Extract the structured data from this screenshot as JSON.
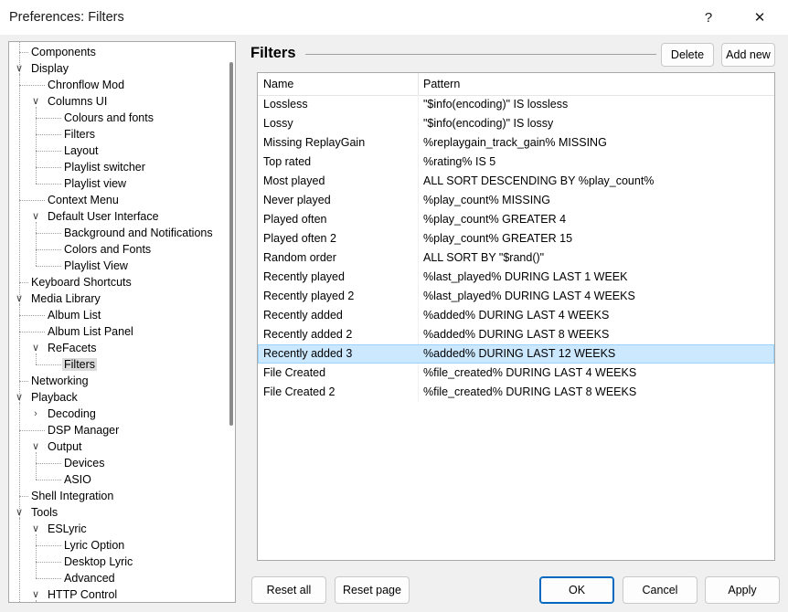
{
  "window": {
    "title": "Preferences: Filters",
    "help_label": "?",
    "close_label": "✕"
  },
  "tree": {
    "items": [
      {
        "label": "Components",
        "level": 0,
        "toggle": "none"
      },
      {
        "label": "Display",
        "level": 0,
        "toggle": "expanded"
      },
      {
        "label": "Chronflow Mod",
        "level": 1,
        "toggle": "none"
      },
      {
        "label": "Columns UI",
        "level": 1,
        "toggle": "expanded"
      },
      {
        "label": "Colours and fonts",
        "level": 2,
        "toggle": "none"
      },
      {
        "label": "Filters",
        "level": 2,
        "toggle": "none"
      },
      {
        "label": "Layout",
        "level": 2,
        "toggle": "none"
      },
      {
        "label": "Playlist switcher",
        "level": 2,
        "toggle": "none"
      },
      {
        "label": "Playlist view",
        "level": 2,
        "toggle": "none"
      },
      {
        "label": "Context Menu",
        "level": 1,
        "toggle": "none"
      },
      {
        "label": "Default User Interface",
        "level": 1,
        "toggle": "expanded"
      },
      {
        "label": "Background and Notifications",
        "level": 2,
        "toggle": "none"
      },
      {
        "label": "Colors and Fonts",
        "level": 2,
        "toggle": "none"
      },
      {
        "label": "Playlist View",
        "level": 2,
        "toggle": "none"
      },
      {
        "label": "Keyboard Shortcuts",
        "level": 0,
        "toggle": "none"
      },
      {
        "label": "Media Library",
        "level": 0,
        "toggle": "expanded"
      },
      {
        "label": "Album List",
        "level": 1,
        "toggle": "none"
      },
      {
        "label": "Album List Panel",
        "level": 1,
        "toggle": "none"
      },
      {
        "label": "ReFacets",
        "level": 1,
        "toggle": "expanded"
      },
      {
        "label": "Filters",
        "level": 2,
        "toggle": "none",
        "selected": true
      },
      {
        "label": "Networking",
        "level": 0,
        "toggle": "none"
      },
      {
        "label": "Playback",
        "level": 0,
        "toggle": "expanded"
      },
      {
        "label": "Decoding",
        "level": 1,
        "toggle": "collapsed"
      },
      {
        "label": "DSP Manager",
        "level": 1,
        "toggle": "none"
      },
      {
        "label": "Output",
        "level": 1,
        "toggle": "expanded"
      },
      {
        "label": "Devices",
        "level": 2,
        "toggle": "none"
      },
      {
        "label": "ASIO",
        "level": 2,
        "toggle": "none"
      },
      {
        "label": "Shell Integration",
        "level": 0,
        "toggle": "none"
      },
      {
        "label": "Tools",
        "level": 0,
        "toggle": "expanded"
      },
      {
        "label": "ESLyric",
        "level": 1,
        "toggle": "expanded"
      },
      {
        "label": "Lyric Option",
        "level": 2,
        "toggle": "none"
      },
      {
        "label": "Desktop Lyric",
        "level": 2,
        "toggle": "none"
      },
      {
        "label": "Advanced",
        "level": 2,
        "toggle": "none"
      },
      {
        "label": "HTTP Control",
        "level": 1,
        "toggle": "expanded"
      }
    ]
  },
  "panel": {
    "heading": "Filters",
    "delete_label": "Delete",
    "add_new_label": "Add new"
  },
  "filters_table": {
    "columns": [
      "Name",
      "Pattern"
    ],
    "rows": [
      {
        "name": "Lossless",
        "pattern": "\"$info(encoding)\" IS lossless"
      },
      {
        "name": "Lossy",
        "pattern": "\"$info(encoding)\" IS lossy"
      },
      {
        "name": "Missing ReplayGain",
        "pattern": "%replaygain_track_gain% MISSING"
      },
      {
        "name": "Top rated",
        "pattern": "%rating% IS 5"
      },
      {
        "name": "Most played",
        "pattern": "ALL SORT DESCENDING BY %play_count%"
      },
      {
        "name": "Never played",
        "pattern": "%play_count% MISSING"
      },
      {
        "name": "Played often",
        "pattern": "%play_count% GREATER 4"
      },
      {
        "name": "Played often 2",
        "pattern": "%play_count% GREATER 15"
      },
      {
        "name": "Random order",
        "pattern": "ALL SORT BY \"$rand()\""
      },
      {
        "name": "Recently played",
        "pattern": "%last_played% DURING LAST 1 WEEK"
      },
      {
        "name": "Recently played 2",
        "pattern": "%last_played% DURING LAST 4 WEEKS"
      },
      {
        "name": "Recently added",
        "pattern": "%added% DURING LAST 4 WEEKS"
      },
      {
        "name": "Recently added 2",
        "pattern": "%added% DURING LAST 8 WEEKS"
      },
      {
        "name": "Recently added 3",
        "pattern": "%added% DURING LAST 12 WEEKS",
        "selected": true
      },
      {
        "name": "File Created",
        "pattern": "%file_created% DURING LAST 4 WEEKS"
      },
      {
        "name": "File Created 2",
        "pattern": "%file_created% DURING LAST 8 WEEKS"
      }
    ]
  },
  "footer": {
    "reset_all_label": "Reset all",
    "reset_page_label": "Reset page",
    "ok_label": "OK",
    "cancel_label": "Cancel",
    "apply_label": "Apply"
  },
  "colors": {
    "selection_bg": "#cce8ff",
    "selection_border": "#99d1ff",
    "primary_border": "#0067c0"
  },
  "icons": {
    "expanded": "chevron-down-icon",
    "collapsed": "chevron-right-icon"
  }
}
